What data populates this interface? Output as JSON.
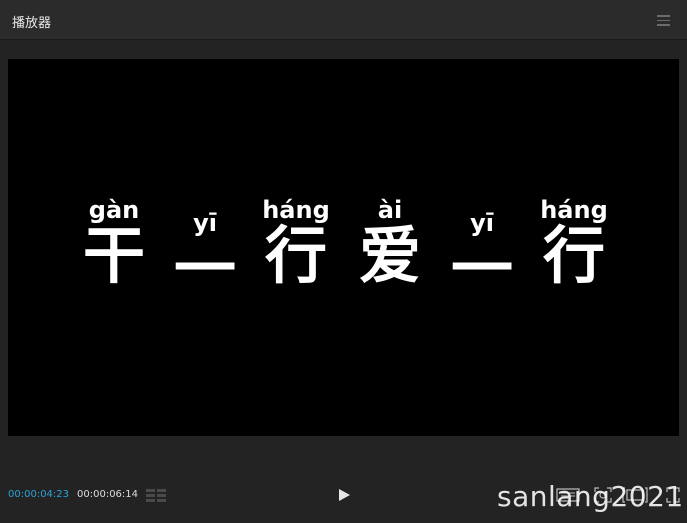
{
  "window": {
    "title": "播放器"
  },
  "subtitle": {
    "items": [
      {
        "pinyin": "gàn",
        "hanzi": "干"
      },
      {
        "pinyin": "yī",
        "hanzi": "一"
      },
      {
        "pinyin": "háng",
        "hanzi": "行"
      },
      {
        "pinyin": "ài",
        "hanzi": "爱"
      },
      {
        "pinyin": "yī",
        "hanzi": "一"
      },
      {
        "pinyin": "háng",
        "hanzi": "行"
      }
    ]
  },
  "playback": {
    "current_time": "00:00:04:23",
    "total_time": "00:00:06:14"
  },
  "watermark": {
    "text": "sanlang2021"
  },
  "colors": {
    "accent": "#2aa3d7",
    "background": "#232323",
    "video_bg": "#000000"
  },
  "icons": [
    "menu-icon",
    "marker-icon",
    "play-icon",
    "safe-frame-icon",
    "snapshot-icon",
    "caption-icon",
    "fullscreen-icon"
  ]
}
